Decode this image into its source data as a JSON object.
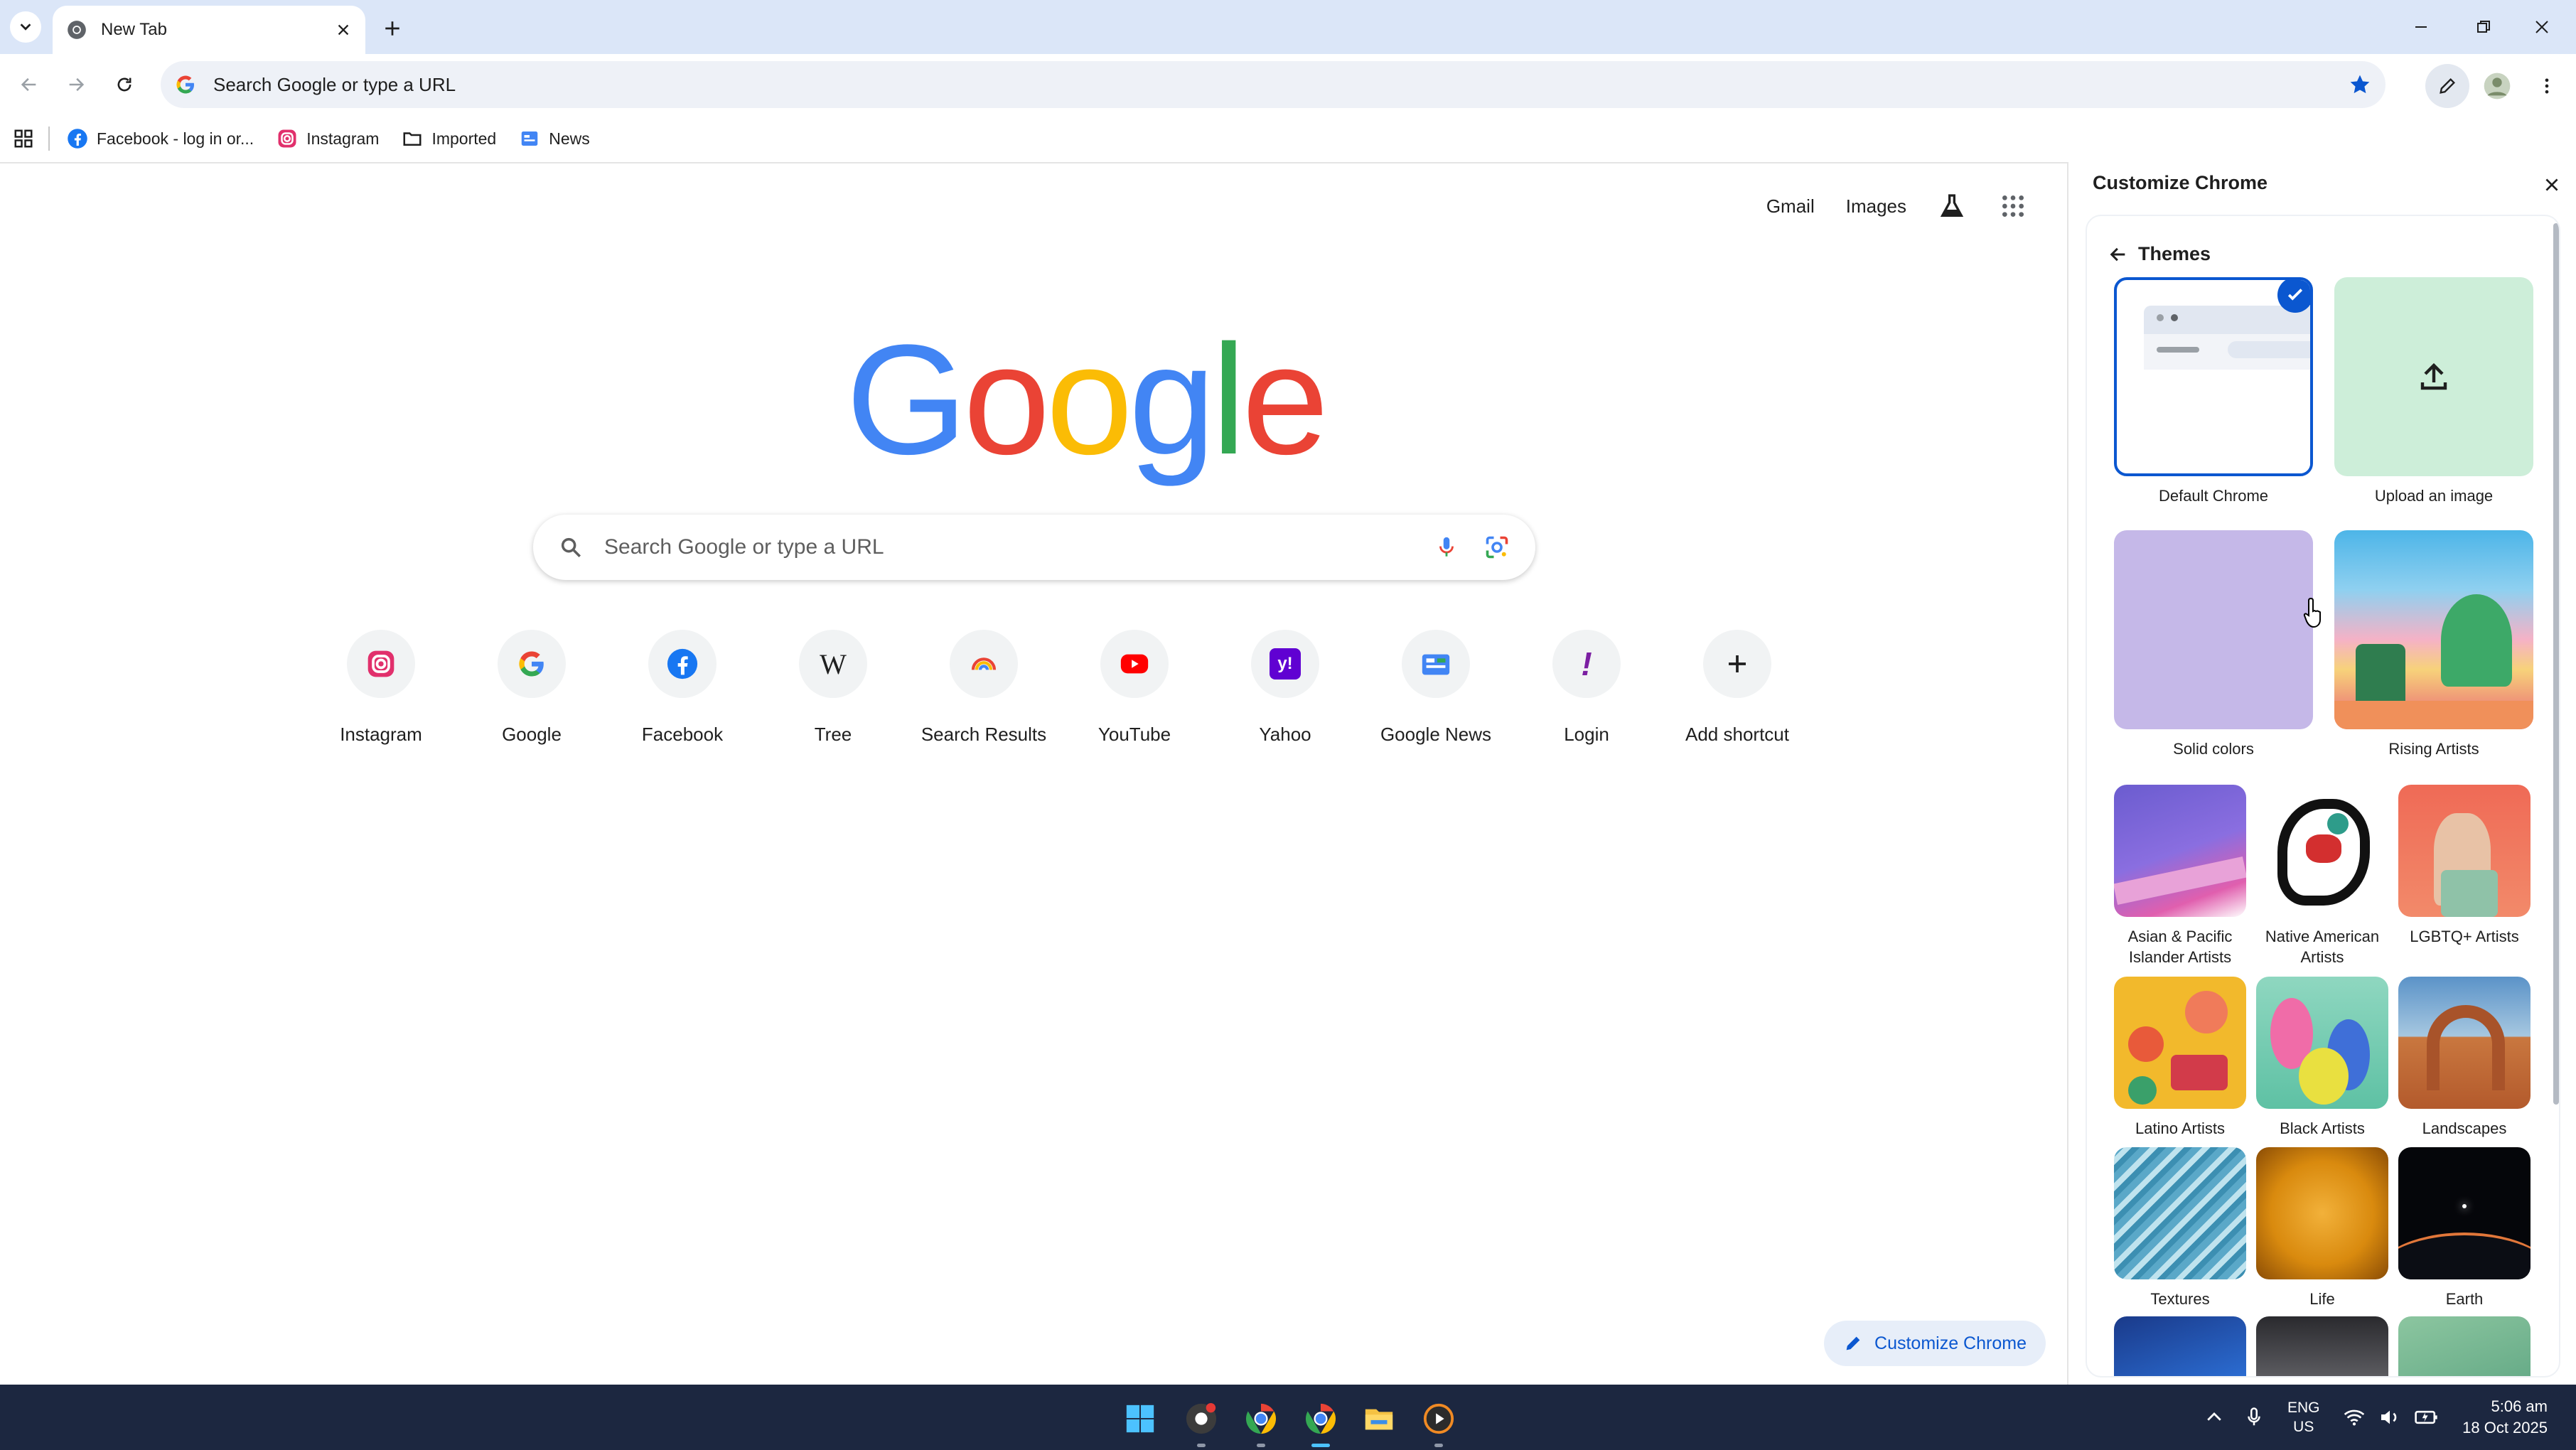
{
  "tabstrip": {
    "active_tab_title": "New Tab"
  },
  "toolbar": {
    "omnibox_text": "Search Google or type a URL"
  },
  "bookmarks": [
    {
      "label": "Facebook - log in or...",
      "icon": "facebook-icon"
    },
    {
      "label": "Instagram",
      "icon": "instagram-icon"
    },
    {
      "label": "Imported",
      "icon": "folder-icon"
    },
    {
      "label": "News",
      "icon": "news-icon"
    }
  ],
  "ntp": {
    "links": {
      "gmail": "Gmail",
      "images": "Images"
    },
    "logo": [
      "G",
      "o",
      "o",
      "g",
      "l",
      "e"
    ],
    "search_placeholder": "Search Google or type a URL",
    "shortcuts": [
      {
        "label": "Instagram",
        "icon": "instagram-icon"
      },
      {
        "label": "Google",
        "icon": "google-icon"
      },
      {
        "label": "Facebook",
        "icon": "facebook-icon"
      },
      {
        "label": "Tree",
        "icon": "wikipedia-icon"
      },
      {
        "label": "Search Results",
        "icon": "rainbow-icon"
      },
      {
        "label": "YouTube",
        "icon": "youtube-icon"
      },
      {
        "label": "Yahoo",
        "icon": "yahoo-icon"
      },
      {
        "label": "Google News",
        "icon": "google-news-icon"
      },
      {
        "label": "Login",
        "icon": "exclamation-icon"
      },
      {
        "label": "Add shortcut",
        "icon": "plus-icon"
      }
    ],
    "customize_button": "Customize Chrome"
  },
  "side_panel": {
    "title": "Customize Chrome",
    "section_title": "Themes",
    "themes_large": [
      {
        "label": "Default Chrome",
        "selected": true
      },
      {
        "label": "Upload an image"
      },
      {
        "label": "Solid colors"
      },
      {
        "label": "Rising Artists"
      }
    ],
    "themes_small": [
      {
        "label": "Asian & Pacific Islander Artists"
      },
      {
        "label": "Native American Artists"
      },
      {
        "label": "LGBTQ+ Artists"
      },
      {
        "label": "Latino Artists"
      },
      {
        "label": "Black Artists"
      },
      {
        "label": "Landscapes"
      },
      {
        "label": "Textures"
      },
      {
        "label": "Life"
      },
      {
        "label": "Earth"
      }
    ]
  },
  "taskbar": {
    "lang_line1": "ENG",
    "lang_line2": "US",
    "time": "5:06 am",
    "date": "18 Oct 2025"
  },
  "colors": {
    "accent": "#0b57d0",
    "tabstrip_bg": "#dbe6f8",
    "taskbar_bg": "#1c2740",
    "google_blue": "#4285f4",
    "google_red": "#ea4335",
    "google_yellow": "#fbbc05",
    "google_green": "#34a853"
  }
}
